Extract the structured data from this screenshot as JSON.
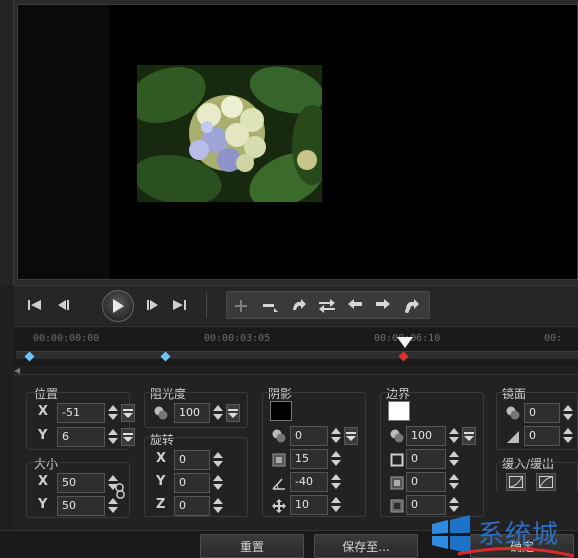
{
  "timeline": {
    "ticks": [
      "00:00:00:00",
      "00:00:03:05",
      "00:00:06:10",
      "00:"
    ]
  },
  "position": {
    "title": "位置",
    "x_label": "X",
    "x_value": "-51",
    "y_label": "Y",
    "y_value": "6"
  },
  "size": {
    "title": "大小",
    "x_label": "X",
    "x_value": "50",
    "y_label": "Y",
    "y_value": "50"
  },
  "opacity": {
    "title": "阻光度",
    "value": "100"
  },
  "rotation": {
    "title": "旋转",
    "x_label": "X",
    "x_value": "0",
    "y_label": "Y",
    "y_value": "0",
    "z_label": "Z",
    "z_value": "0"
  },
  "shadow": {
    "title": "阴影",
    "color": "#000000",
    "opacity_value": "0",
    "blur_value": "15",
    "angle_value": "-40",
    "distance_value": "10"
  },
  "border": {
    "title": "边界",
    "color": "#ffffff",
    "opacity_value": "100",
    "v1": "0",
    "v2": "0",
    "v3": "0"
  },
  "mirror": {
    "title": "镜面",
    "v1": "0",
    "v2": "0"
  },
  "ease": {
    "title": "缓入/缓出"
  },
  "buttons": {
    "reset": "重置",
    "save_as": "保存至...",
    "ok": "确定"
  },
  "watermark": {
    "text": "系统城"
  }
}
